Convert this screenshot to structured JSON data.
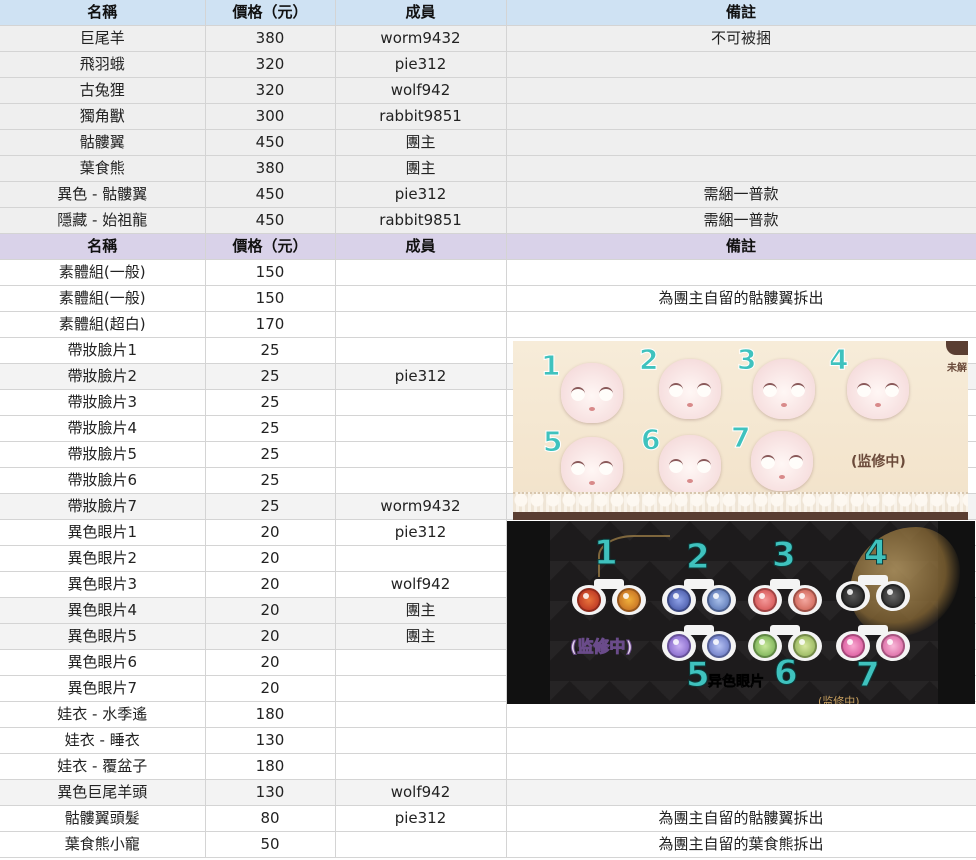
{
  "table1": {
    "headers": [
      "名稱",
      "價格（元）",
      "成員",
      "備註"
    ],
    "rows": [
      {
        "name": "巨尾羊",
        "price": "380",
        "member": "worm9432",
        "note": "不可被捆"
      },
      {
        "name": "飛羽蛾",
        "price": "320",
        "member": "pie312",
        "note": ""
      },
      {
        "name": "古兔狸",
        "price": "320",
        "member": "wolf942",
        "note": ""
      },
      {
        "name": "獨角獸",
        "price": "300",
        "member": "rabbit9851",
        "note": ""
      },
      {
        "name": "骷髏翼",
        "price": "450",
        "member": "團主",
        "note": ""
      },
      {
        "name": "葉食熊",
        "price": "380",
        "member": "團主",
        "note": ""
      },
      {
        "name": "異色 - 骷髏翼",
        "price": "450",
        "member": "pie312",
        "note": "需綑一普款"
      },
      {
        "name": "隱藏 - 始祖龍",
        "price": "450",
        "member": "rabbit9851",
        "note": "需綑一普款"
      }
    ]
  },
  "table2": {
    "headers": [
      "名稱",
      "價格（元）",
      "成員",
      "備註"
    ],
    "rows": [
      {
        "name": "素體組(一般)",
        "price": "150",
        "member": "",
        "note": ""
      },
      {
        "name": "素體組(一般)",
        "price": "150",
        "member": "",
        "note": "為團主自留的骷髏翼拆出"
      },
      {
        "name": "素體組(超白)",
        "price": "170",
        "member": "",
        "note": ""
      },
      {
        "name": "帶妝臉片1",
        "price": "25",
        "member": "",
        "note": ""
      },
      {
        "name": "帶妝臉片2",
        "price": "25",
        "member": "pie312",
        "note": ""
      },
      {
        "name": "帶妝臉片3",
        "price": "25",
        "member": "",
        "note": ""
      },
      {
        "name": "帶妝臉片4",
        "price": "25",
        "member": "",
        "note": ""
      },
      {
        "name": "帶妝臉片5",
        "price": "25",
        "member": "",
        "note": ""
      },
      {
        "name": "帶妝臉片6",
        "price": "25",
        "member": "",
        "note": ""
      },
      {
        "name": "帶妝臉片7",
        "price": "25",
        "member": "worm9432",
        "note": ""
      },
      {
        "name": "異色眼片1",
        "price": "20",
        "member": "pie312",
        "note": ""
      },
      {
        "name": "異色眼片2",
        "price": "20",
        "member": "",
        "note": ""
      },
      {
        "name": "異色眼片3",
        "price": "20",
        "member": "wolf942",
        "note": ""
      },
      {
        "name": "異色眼片4",
        "price": "20",
        "member": "團主",
        "note": ""
      },
      {
        "name": "異色眼片5",
        "price": "20",
        "member": "團主",
        "note": ""
      },
      {
        "name": "異色眼片6",
        "price": "20",
        "member": "",
        "note": ""
      },
      {
        "name": "異色眼片7",
        "price": "20",
        "member": "",
        "note": ""
      },
      {
        "name": "娃衣 - 水季遙",
        "price": "180",
        "member": "",
        "note": ""
      },
      {
        "name": "娃衣 - 睡衣",
        "price": "130",
        "member": "",
        "note": ""
      },
      {
        "name": "娃衣 - 覆盆子",
        "price": "180",
        "member": "",
        "note": ""
      },
      {
        "name": "異色巨尾羊頭",
        "price": "130",
        "member": "wolf942",
        "note": ""
      },
      {
        "name": "骷髏翼頭髮",
        "price": "80",
        "member": "pie312",
        "note": "為團主自留的骷髏翼拆出"
      },
      {
        "name": "葉食熊小寵",
        "price": "50",
        "member": "",
        "note": "為團主自留的葉食熊拆出"
      }
    ]
  },
  "makeup_image": {
    "numbers": [
      "1",
      "2",
      "3",
      "4",
      "5",
      "6",
      "7"
    ],
    "monitor_label": "(监修中)",
    "side_label": "未解"
  },
  "eye_image": {
    "numbers": [
      "1",
      "2",
      "3",
      "4",
      "5",
      "6",
      "7"
    ],
    "monitor_label": "(监修中)",
    "caption": "异色眼片",
    "cut_label": "(监修中)"
  },
  "colors": {
    "header1": "#cfe2f3",
    "header2": "#d9d2e9",
    "accent_number": "#3fc2be"
  }
}
